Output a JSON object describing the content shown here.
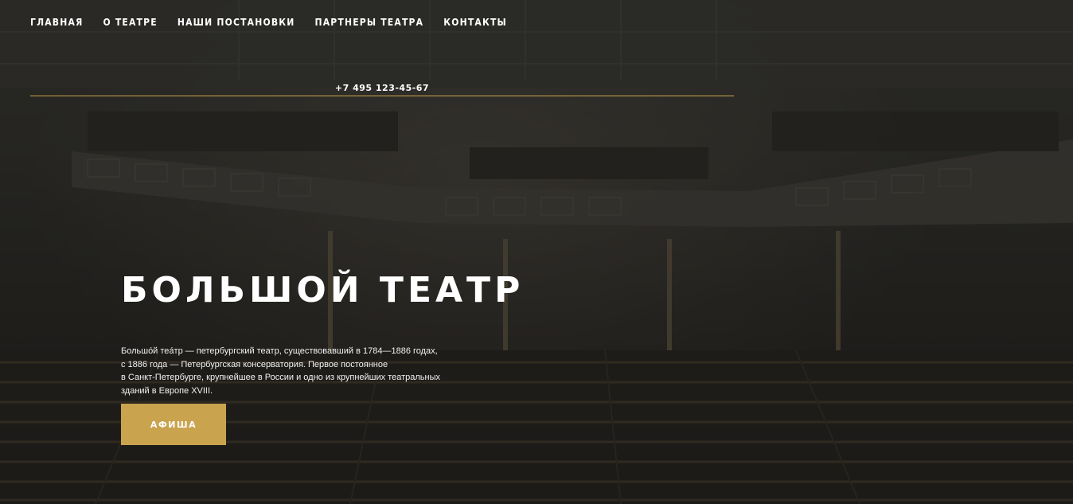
{
  "nav": {
    "items": [
      {
        "label": "ГЛАВНАЯ"
      },
      {
        "label": "О ТЕАТРЕ"
      },
      {
        "label": "НАШИ ПОСТАНОВКИ"
      },
      {
        "label": "ПАРТНЕРЫ ТЕАТРА"
      },
      {
        "label": "КОНТАКТЫ"
      }
    ]
  },
  "header": {
    "phone": "+7 495 123-45-67"
  },
  "hero": {
    "title": "БОЛЬШОЙ ТЕАТР",
    "description_lines": [
      "Большо́й теа́тр — петербургский театр, существовавший в 1784—1886 годах,",
      "с 1886 года — Петербургская консерватория. Первое постоянное",
      "в Санкт-Петербурге, крупнейшее в России и одно из крупнейших театральных",
      "зданий в Европе XVIII."
    ],
    "button_label": "АФИША"
  },
  "colors": {
    "accent": "#c9a34e",
    "text": "#ffffff",
    "background": "#2b2a27"
  }
}
